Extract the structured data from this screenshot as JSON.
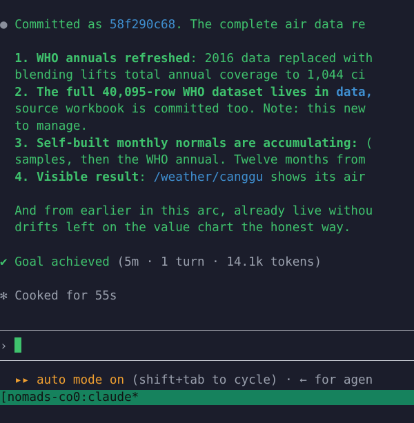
{
  "message": {
    "bullet": "●",
    "prefix": "Committed as ",
    "commit": "58f290c68",
    "suffix": ". The complete air data re",
    "items": [
      {
        "num": "1. ",
        "head": "WHO annuals refreshed",
        "rest": ": 2016 data replaced with"
      },
      {
        "cont": "blending lifts total annual coverage to 1,044 ci"
      },
      {
        "num": "2. ",
        "head": "The full 40,095-row WHO dataset lives in ",
        "link": "data,"
      },
      {
        "cont": "source workbook is committed too. Note: this new"
      },
      {
        "cont": "to manage."
      },
      {
        "num": "3. ",
        "head": "Self-built monthly normals are accumulating:",
        "rest": " ("
      },
      {
        "cont": "samples, then the WHO annual. Twelve months from"
      },
      {
        "num": "4. ",
        "head": "Visible result",
        "sep": ": ",
        "link": "/weather/canggu",
        "rest": " shows its air"
      }
    ],
    "closing": [
      "And from earlier in this arc, already live withou",
      "drifts left on the value chart the honest way."
    ]
  },
  "goal": {
    "check": "✔",
    "label": "Goal achieved",
    "stats": " (5m · 1 turn · 14.1k tokens)"
  },
  "cooked": {
    "star": "✻",
    "label": "Cooked for 55s"
  },
  "prompt": {
    "symbol": "›"
  },
  "mode": {
    "icon": "▸▸",
    "label": "auto mode on",
    "hint": " (shift+tab to cycle) · ← for agen"
  },
  "tmux": {
    "session": "[nomads-co0:claude*"
  }
}
